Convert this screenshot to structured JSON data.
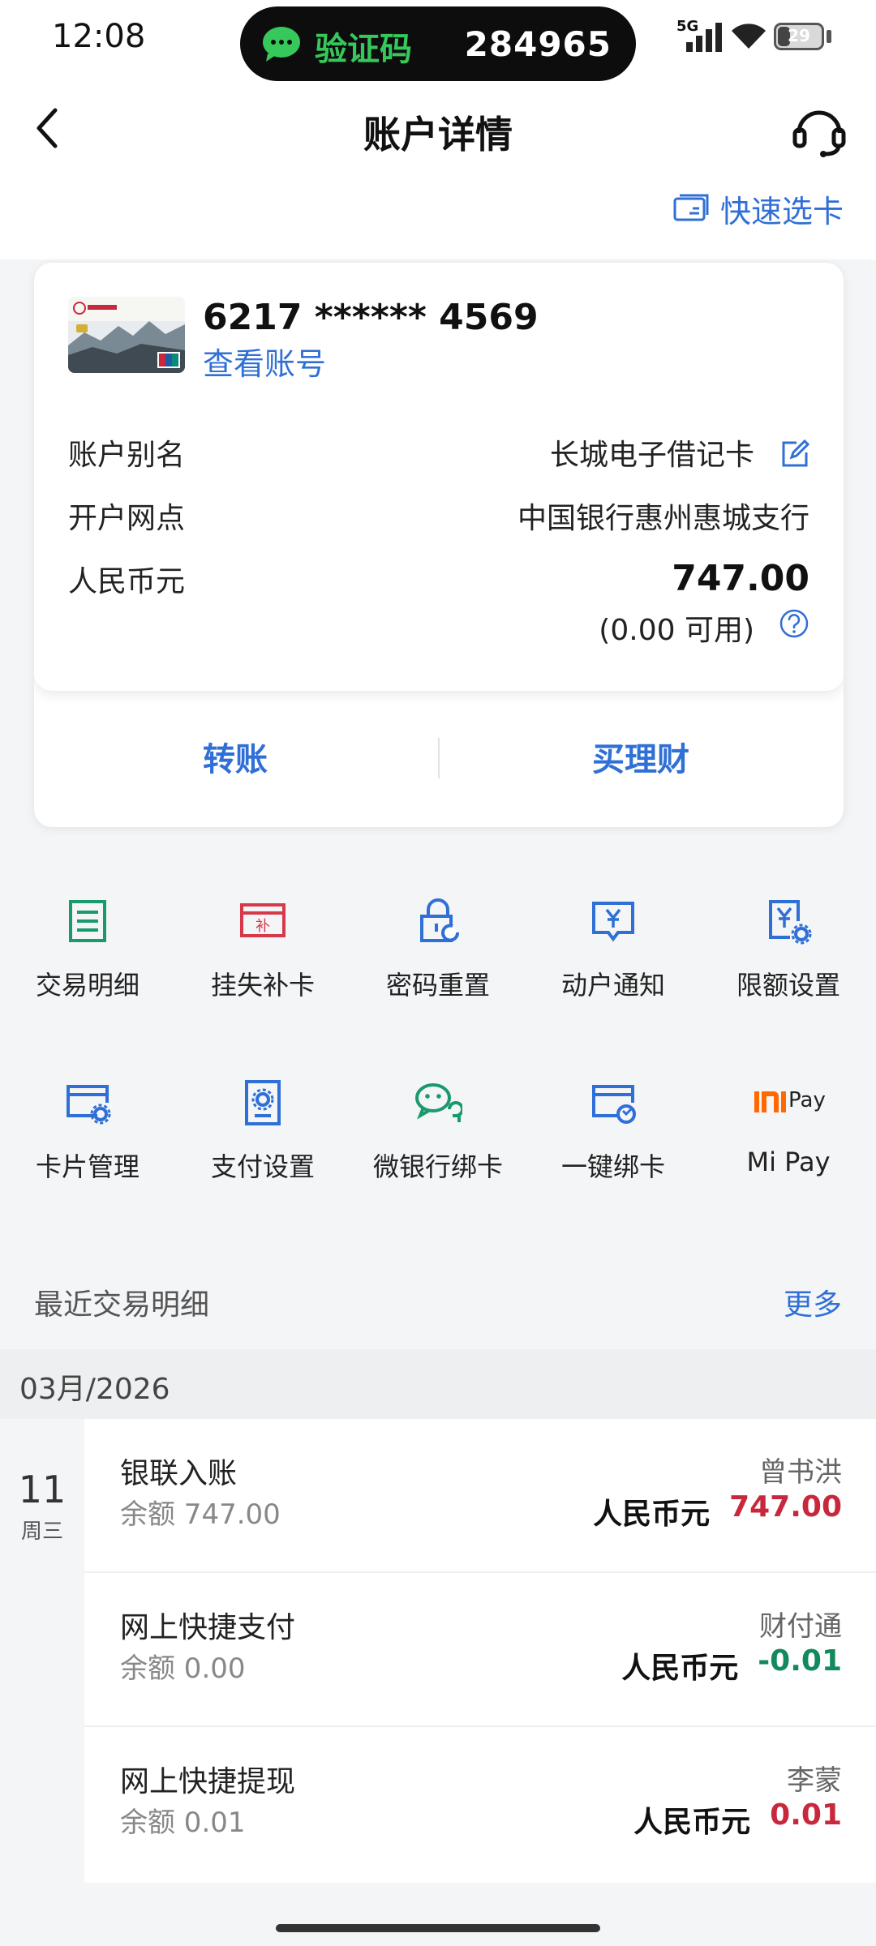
{
  "status_bar": {
    "time": "12:08",
    "sms_label": "验证码",
    "sms_code": "284965",
    "network": "5G",
    "battery": "29",
    "battery_level": 0.29
  },
  "header": {
    "title": "账户详情",
    "quick_select": "快速选卡"
  },
  "card": {
    "number": "6217 ****** 4569",
    "view_account": "查看账号",
    "rows": {
      "alias_label": "账户别名",
      "alias_value": "长城电子借记卡",
      "branch_label": "开户网点",
      "branch_value": "中国银行惠州惠城支行",
      "currency_label": "人民币元",
      "balance": "747.00",
      "available": "(0.00 可用)"
    },
    "actions": {
      "transfer": "转账",
      "buy_wealth": "买理财"
    }
  },
  "services": [
    {
      "label": "交易明细",
      "icon": "transaction-detail-icon",
      "color": "#1a9a6c"
    },
    {
      "label": "挂失补卡",
      "icon": "report-loss-icon",
      "color": "#d63a4a"
    },
    {
      "label": "密码重置",
      "icon": "password-reset-icon",
      "color": "#2f6fd6"
    },
    {
      "label": "动户通知",
      "icon": "account-notice-icon",
      "color": "#2f6fd6"
    },
    {
      "label": "限额设置",
      "icon": "limit-setting-icon",
      "color": "#2f6fd6"
    },
    {
      "label": "卡片管理",
      "icon": "card-management-icon",
      "color": "#2f6fd6"
    },
    {
      "label": "支付设置",
      "icon": "payment-setting-icon",
      "color": "#2f6fd6"
    },
    {
      "label": "微银行绑卡",
      "icon": "wechat-bind-icon",
      "color": "#1a9a6c"
    },
    {
      "label": "一键绑卡",
      "icon": "one-click-bind-icon",
      "color": "#2f6fd6"
    },
    {
      "label": "Mi Pay",
      "icon": "mi-pay-icon",
      "color": "#ff6900",
      "logo_text": "Pay"
    }
  ],
  "recent": {
    "title": "最近交易明细",
    "more": "更多",
    "month": "03月/2026",
    "day": "11",
    "weekday": "周三",
    "transactions": [
      {
        "title": "银联入账",
        "balance": "余额 747.00",
        "counterparty": "曾书洪",
        "currency": "人民币元",
        "amount": "747.00",
        "amount_color": "#c8283c"
      },
      {
        "title": "网上快捷支付",
        "balance": "余额 0.00",
        "counterparty": "财付通",
        "currency": "人民币元",
        "amount": "-0.01",
        "amount_color": "#128a5e"
      },
      {
        "title": "网上快捷提现",
        "balance": "余额 0.01",
        "counterparty": "李蒙",
        "currency": "人民币元",
        "amount": "0.01",
        "amount_color": "#c8283c"
      }
    ]
  }
}
